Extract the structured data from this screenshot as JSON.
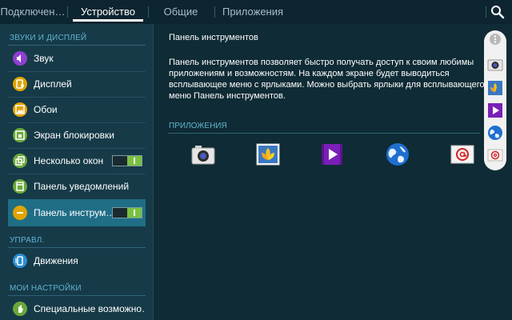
{
  "tabs": [
    {
      "label": "Подключен…"
    },
    {
      "label": "Устройство"
    },
    {
      "label": "Общие"
    },
    {
      "label": "Приложения"
    }
  ],
  "sidebar": {
    "section_sound": "ЗВУКИ И ДИСПЛЕЙ",
    "section_control": "УПРАВЛ.",
    "section_my": "МОИ НАСТРОЙКИ",
    "items": [
      {
        "label": "Звук",
        "icon": "speaker-icon",
        "color": "#8e3fd1"
      },
      {
        "label": "Дисплей",
        "icon": "display-icon",
        "color": "#e0a400"
      },
      {
        "label": "Обои",
        "icon": "wallpaper-icon",
        "color": "#e0a400"
      },
      {
        "label": "Экран блокировки",
        "icon": "lock-screen-icon",
        "color": "#6aa83a"
      },
      {
        "label": "Несколько окон",
        "icon": "multi-window-icon",
        "color": "#6aa83a",
        "toggle": "on"
      },
      {
        "label": "Панель уведомлений",
        "icon": "notification-panel-icon",
        "color": "#6aa83a"
      },
      {
        "label": "Панель инструм…",
        "icon": "toolbox-icon",
        "color": "#e0a400",
        "toggle": "on"
      },
      {
        "label": "Движения",
        "icon": "motion-icon",
        "color": "#2a8fd6"
      },
      {
        "label": "Специальные возможно…",
        "icon": "accessibility-icon",
        "color": "#6aa83a"
      }
    ]
  },
  "content": {
    "title": "Панель инструментов",
    "description": "Панель инструментов позволяет быстро получать доступ к своим любимы приложениям и возможностям. На каждом экране будет выводиться всплывающее меню с ярлыками. Можно выбрать ярлыки для всплывающего меню Панель инструментов.",
    "apps_header": "ПРИЛОЖЕНИЯ",
    "apps": [
      {
        "icon": "camera-icon"
      },
      {
        "icon": "gallery-icon"
      },
      {
        "icon": "video-player-icon"
      },
      {
        "icon": "internet-icon"
      },
      {
        "icon": "email-icon"
      }
    ]
  },
  "colors": {
    "accent": "#5fb4d0",
    "selected": "#1f6e86",
    "toggle_on": "#79c043"
  }
}
